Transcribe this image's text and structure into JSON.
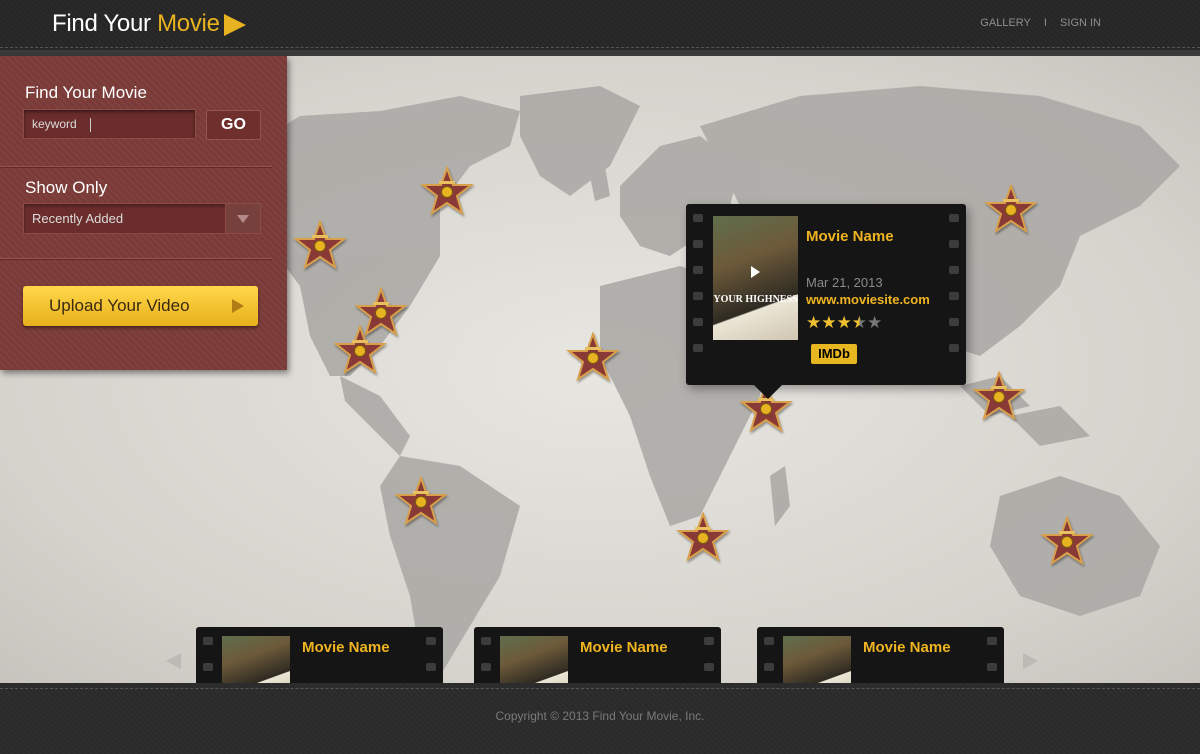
{
  "header": {
    "logo_main": "Find Your ",
    "logo_accent": "Movie",
    "nav": [
      {
        "label": "GALLERY"
      },
      {
        "label": "SIGN IN"
      }
    ],
    "nav_separator": "I"
  },
  "sidebar": {
    "search_title": "Find Your Movie",
    "search_value": "keyword",
    "go_label": "GO",
    "filter_title": "Show Only",
    "filter_selected": "Recently Added",
    "upload_label": "Upload Your Video"
  },
  "popup": {
    "poster_title": "YOUR HIGHNESS",
    "movie_name": "Movie Name",
    "date": "Mar 21, 2013",
    "website": "www.moviesite.com",
    "rating": 3.5,
    "rating_max": 5,
    "imdb_label": "IMDb"
  },
  "carousel": {
    "cards": [
      {
        "title": "Movie Name"
      },
      {
        "title": "Movie Name"
      },
      {
        "title": "Movie Name"
      }
    ]
  },
  "footer": {
    "copyright": "Copyright © 2013 Find Your Movie, Inc."
  },
  "colors": {
    "accent": "#e8b320",
    "sidebar": "#7a3b38",
    "header": "#262626",
    "star": "#8a3a36"
  },
  "icons": [
    "play-icon",
    "star-marker-icon",
    "chevron-left-icon",
    "chevron-right-icon",
    "dropdown-arrow-icon"
  ]
}
